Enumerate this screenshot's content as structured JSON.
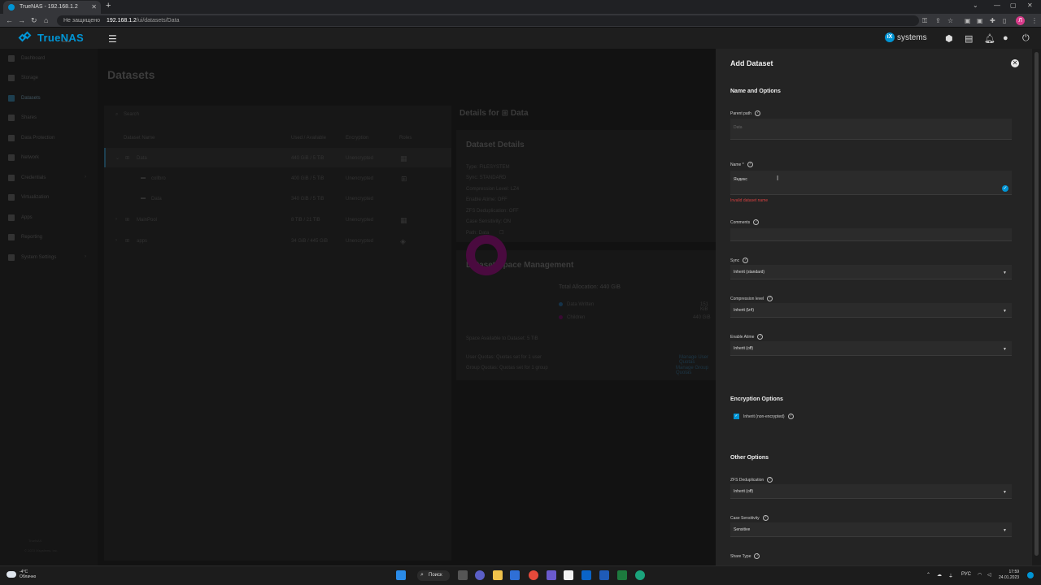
{
  "browser": {
    "tab_title": "TrueNAS - 192.168.1.2",
    "address_insecure": "Не защищено",
    "address_host": "192.168.1.2",
    "address_path": "/ui/datasets/Data",
    "profile_initial": "Л"
  },
  "topbar": {
    "logo_text": "TrueNAS",
    "logo_sub": "SCALE",
    "ixsystems": "systems",
    "ix_badge": "iX"
  },
  "sidebar": {
    "items": [
      {
        "label": "Dashboard"
      },
      {
        "label": "Storage"
      },
      {
        "label": "Datasets"
      },
      {
        "label": "Shares"
      },
      {
        "label": "Data Protection"
      },
      {
        "label": "Network"
      },
      {
        "label": "Credentials"
      },
      {
        "label": "Virtualization"
      },
      {
        "label": "Apps"
      },
      {
        "label": "Reporting"
      },
      {
        "label": "System Settings"
      }
    ],
    "footer1": "TrueNAS",
    "footer2": "© 2023 iXsystems, Inc."
  },
  "datasets": {
    "title": "Datasets",
    "search_placeholder": "Search",
    "columns": [
      "Dataset Name",
      "Used / Available",
      "Encryption",
      "Roles"
    ],
    "rows": [
      {
        "name": "Data",
        "used": "440 GiB / 5 TiB",
        "enc": "Unencrypted"
      },
      {
        "name": "collbro",
        "used": "400 GiB / 5 TiB",
        "enc": "Unencrypted"
      },
      {
        "name": "Data",
        "used": "340 GiB / 5 TiB",
        "enc": "Unencrypted"
      },
      {
        "name": "MainPool",
        "used": "8 TiB / 21 TiB",
        "enc": "Unencrypted"
      },
      {
        "name": "apps",
        "used": "34 GiB / 445 GiB",
        "enc": "Unencrypted"
      }
    ],
    "details_for": "Details for",
    "details_name": "Data",
    "dataset_details_title": "Dataset Details",
    "details": [
      "Type: FILESYSTEM",
      "Sync: STANDARD",
      "Compression Level: LZ4",
      "Enable Atime: OFF",
      "ZFS Deduplication: OFF",
      "Case Sensitivity: ON",
      "Path: Data"
    ],
    "space_title": "Dataset Space Management",
    "total_allocation": "Total Allocation: 440 GiB",
    "legend_written": "Data Written",
    "legend_children": "Children",
    "written_val": "151 KiB",
    "children_val": "440 GiB",
    "space_available": "Space Available to Dataset: 5 TiB",
    "user_quotas": "User Quotas: Quotas set for 1 user",
    "group_quotas": "Group Quotas: Quotas set for 1 group",
    "manage_user": "Manage User Quotas",
    "manage_group": "Manage Group Quotas"
  },
  "panel": {
    "title": "Add Dataset",
    "section_name": "Name and Options",
    "parent_path_label": "Parent path",
    "parent_path_value": "Data",
    "name_label": "Name *",
    "name_value": "Яндекс",
    "name_error": "Invalid dataset name",
    "comments_label": "Comments",
    "sync_label": "Sync",
    "sync_value": "Inherit (standard)",
    "compression_label": "Compression level",
    "compression_value": "Inherit (lz4)",
    "atime_label": "Enable Atime",
    "atime_value": "Inherit (off)",
    "section_encryption": "Encryption Options",
    "inherit_encryption": "Inherit (non-encrypted)",
    "section_other": "Other Options",
    "dedup_label": "ZFS Deduplication",
    "dedup_value": "Inherit (off)",
    "case_label": "Case Sensitivity",
    "case_value": "Sensitive",
    "share_label": "Share Type"
  },
  "taskbar": {
    "temp": "-4°C",
    "weather": "Облачно",
    "search": "Поиск",
    "lang": "РУС",
    "time": "17:59",
    "date": "24.01.2023"
  },
  "colors": {
    "accent": "#0095d5",
    "error": "#d64040",
    "panel_bg": "#242424"
  }
}
